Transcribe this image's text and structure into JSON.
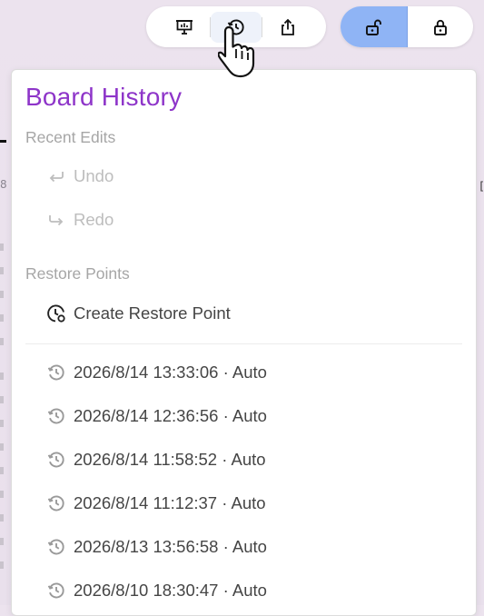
{
  "toolbar": {
    "present_icon": "presentation-icon",
    "history_icon": "history-icon",
    "share_icon": "share-export-icon",
    "unlock_icon": "unlock-icon",
    "lock_icon": "lock-icon"
  },
  "background": {
    "fragment_digit": "8",
    "fragment_right": "["
  },
  "panel": {
    "title": "Board History",
    "recent_edits_label": "Recent Edits",
    "undo_label": "Undo",
    "redo_label": "Redo",
    "restore_points_label": "Restore Points",
    "create_label": "Create Restore Point",
    "restore_points": [
      {
        "label": "2026/8/14 13:33:06 · Auto"
      },
      {
        "label": "2026/8/14 12:36:56 · Auto"
      },
      {
        "label": "2026/8/14 11:58:52 · Auto"
      },
      {
        "label": "2026/8/14 11:12:37 · Auto"
      },
      {
        "label": "2026/8/13 13:56:58 · Auto"
      },
      {
        "label": "2026/8/10 18:30:47 · Auto"
      }
    ]
  },
  "colors": {
    "title": "#8e35c9",
    "lock_selected_bg": "#8fb4f5"
  }
}
